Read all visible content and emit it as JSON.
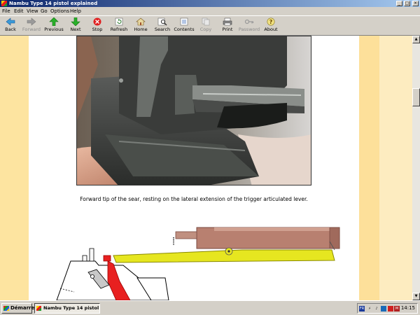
{
  "window": {
    "title": "Nambu Type 14 pistol explained",
    "controls": [
      "_",
      "□",
      "×"
    ]
  },
  "menu": [
    "File",
    "Edit",
    "View",
    "Go",
    "Options",
    "Help"
  ],
  "toolbar": [
    {
      "label": "Back",
      "icon": "back-arrow-icon",
      "enabled": true
    },
    {
      "label": "Forward",
      "icon": "forward-arrow-icon",
      "enabled": false
    },
    {
      "label": "Previous",
      "icon": "up-arrow-icon",
      "enabled": true
    },
    {
      "label": "Next",
      "icon": "down-arrow-icon",
      "enabled": true
    },
    {
      "label": "Stop",
      "icon": "stop-icon",
      "enabled": true
    },
    {
      "label": "Refresh",
      "icon": "refresh-icon",
      "enabled": true
    },
    {
      "label": "Home",
      "icon": "home-icon",
      "enabled": true
    },
    {
      "label": "Search",
      "icon": "search-icon",
      "enabled": true
    },
    {
      "label": "Contents",
      "icon": "contents-icon",
      "enabled": true
    },
    {
      "label": "Copy",
      "icon": "copy-icon",
      "enabled": false
    },
    {
      "label": "Print",
      "icon": "print-icon",
      "enabled": true
    },
    {
      "label": "Password",
      "icon": "key-icon",
      "enabled": false
    },
    {
      "label": "About",
      "icon": "about-icon",
      "enabled": true
    }
  ],
  "page": {
    "caption": "Forward tip of the sear, resting on the lateral extension of the trigger articulated lever."
  },
  "taskbar": {
    "start_label": "Démarrer",
    "task_label": "Nambu Type 14 pistol ...",
    "language": "FR",
    "clock": "14:15"
  },
  "colors": {
    "titlebar_start": "#0a246a",
    "titlebar_end": "#a6caf0",
    "page_margin": "#fde4a0",
    "lever_yellow": "#e6e620",
    "barrel_brown": "#b88070"
  }
}
